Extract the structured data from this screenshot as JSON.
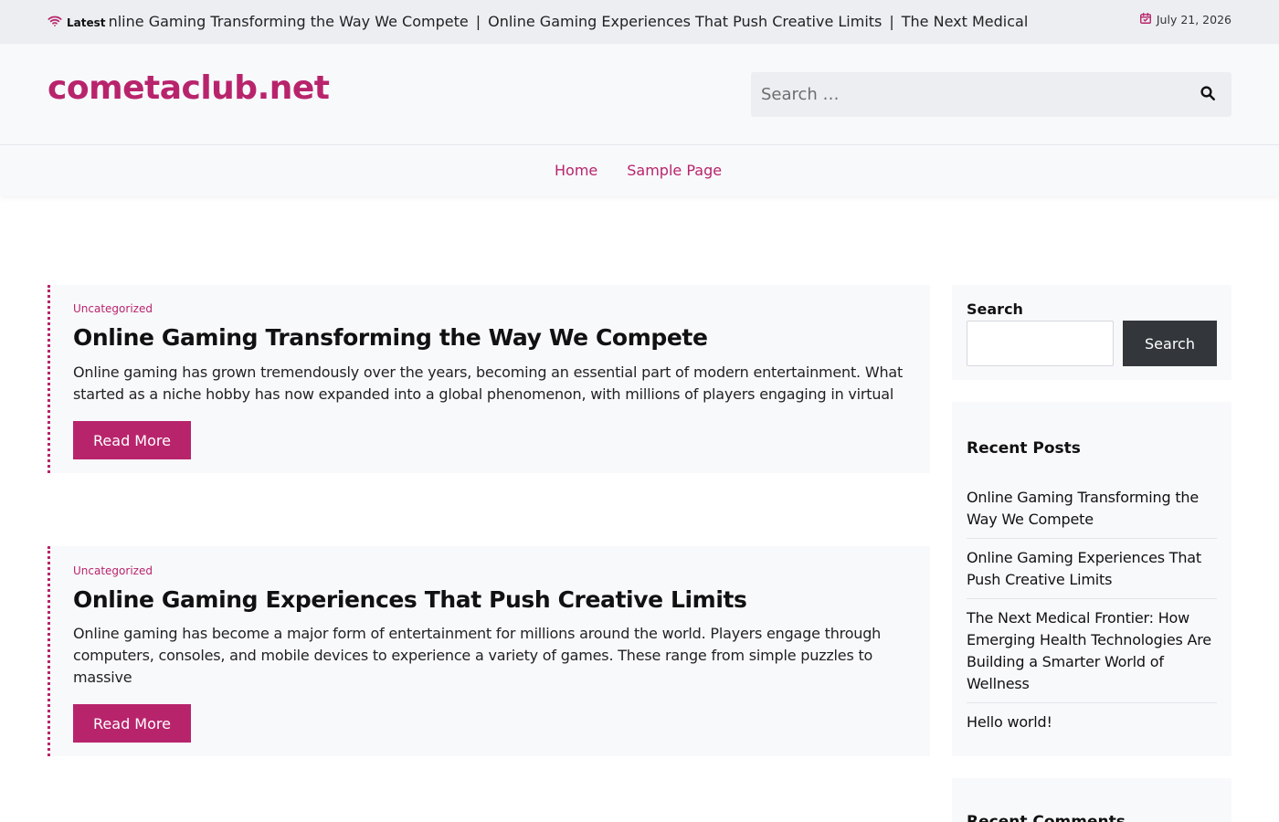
{
  "topbar": {
    "latest_label": "Latest",
    "ticker_items": [
      "Online Gaming Transforming the Way We Compete",
      "Online Gaming Experiences That Push Creative Limits",
      "The Next Medical Frontier: How Emerging Health Technologies Are Building a Smarter World of Wellness"
    ],
    "ticker_separator": "|",
    "date": "July 21, 2026"
  },
  "header": {
    "site_title": "cometaclub.net",
    "search_placeholder": "Search …"
  },
  "nav": {
    "items": [
      {
        "label": "Home"
      },
      {
        "label": "Sample Page"
      }
    ]
  },
  "posts": [
    {
      "category": "Uncategorized",
      "title": "Online Gaming Transforming the Way We Compete",
      "excerpt": "Online gaming has grown tremendously over the years, becoming an essential part of modern entertainment. What started as a niche hobby has now expanded into a global phenomenon, with millions of players engaging in virtual",
      "button": "Read More"
    },
    {
      "category": "Uncategorized",
      "title": "Online Gaming Experiences That Push Creative Limits",
      "excerpt": "Online gaming has become a major form of entertainment for millions around the world. Players engage through computers, consoles, and mobile devices to experience a variety of games. These range from simple puzzles to massive",
      "button": "Read More"
    }
  ],
  "sidebar": {
    "search": {
      "title": "Search",
      "button": "Search"
    },
    "recent_posts": {
      "title": "Recent Posts",
      "items": [
        "Online Gaming Transforming the Way We Compete",
        "Online Gaming Experiences That Push Creative Limits",
        "The Next Medical Frontier: How Emerging Health Technologies Are Building a Smarter World of Wellness",
        "Hello world!"
      ]
    },
    "recent_comments": {
      "title": "Recent Comments"
    }
  },
  "colors": {
    "accent": "#b8246c",
    "dark_button": "#33373b",
    "topbar_bg": "#eceef1",
    "panel_bg": "#f8f9fb"
  },
  "icons": {
    "latest": "wifi-icon",
    "date": "calendar-check-icon",
    "search": "search-icon"
  }
}
